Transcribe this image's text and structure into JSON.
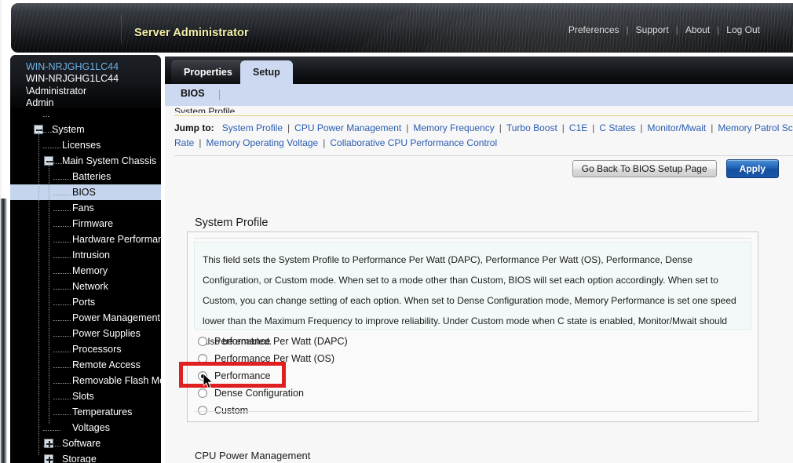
{
  "banner": {
    "app_title": "Server Administrator",
    "nav": [
      {
        "label": "Preferences"
      },
      {
        "label": "Support"
      },
      {
        "label": "About"
      },
      {
        "label": "Log Out"
      }
    ],
    "separator": "|"
  },
  "sidebar": {
    "header": {
      "host_link": "WIN-NRJGHG1LC44",
      "host": "WIN-NRJGHG1LC44",
      "user": "\\Administrator",
      "role": "Admin"
    },
    "tree": [
      {
        "label": "System",
        "toggle": "minus",
        "level": 0
      },
      {
        "label": "Licenses",
        "toggle": "none",
        "level": 1
      },
      {
        "label": "Main System Chassis",
        "toggle": "minus",
        "level": 1
      },
      {
        "label": "Batteries",
        "toggle": "none",
        "level": 2
      },
      {
        "label": "BIOS",
        "toggle": "none",
        "level": 2,
        "selected": true
      },
      {
        "label": "Fans",
        "toggle": "none",
        "level": 2
      },
      {
        "label": "Firmware",
        "toggle": "none",
        "level": 2
      },
      {
        "label": "Hardware Performance",
        "toggle": "none",
        "level": 2
      },
      {
        "label": "Intrusion",
        "toggle": "none",
        "level": 2
      },
      {
        "label": "Memory",
        "toggle": "none",
        "level": 2
      },
      {
        "label": "Network",
        "toggle": "none",
        "level": 2
      },
      {
        "label": "Ports",
        "toggle": "none",
        "level": 2
      },
      {
        "label": "Power Management",
        "toggle": "none",
        "level": 2
      },
      {
        "label": "Power Supplies",
        "toggle": "none",
        "level": 2
      },
      {
        "label": "Processors",
        "toggle": "none",
        "level": 2
      },
      {
        "label": "Remote Access",
        "toggle": "none",
        "level": 2
      },
      {
        "label": "Removable Flash Media",
        "toggle": "none",
        "level": 2
      },
      {
        "label": "Slots",
        "toggle": "none",
        "level": 2
      },
      {
        "label": "Temperatures",
        "toggle": "none",
        "level": 2
      },
      {
        "label": "Voltages",
        "toggle": "none",
        "level": 2
      },
      {
        "label": "Software",
        "toggle": "plus",
        "level": 1
      },
      {
        "label": "Storage",
        "toggle": "plus",
        "level": 1
      }
    ]
  },
  "tabs": [
    {
      "label": "Properties",
      "active": false
    },
    {
      "label": "Setup",
      "active": true
    }
  ],
  "subbar": {
    "crumb": "BIOS"
  },
  "jump": {
    "label": "Jump to:",
    "separator": "|",
    "links": [
      "System Profile",
      "CPU Power Management",
      "Memory Frequency",
      "Turbo Boost",
      "C1E",
      "C States",
      "Monitor/Mwait",
      "Memory Patrol Scrub",
      "Memory Refresh Rate",
      "Memory Operating Voltage",
      "Collaborative CPU Performance Control"
    ]
  },
  "buttons": {
    "go_back": "Go Back To BIOS Setup Page",
    "apply": "Apply"
  },
  "section": {
    "title": "System Profile",
    "description": "This field sets the System Profile to Performance Per Watt (DAPC), Performance Per Watt (OS), Performance, Dense Configuration, or Custom mode. When set to a mode other than Custom, BIOS will set each option accordingly. When set to Custom, you can change setting of each option. When set to Dense Configuration mode, Memory Performance is set one speed lower than the Maximum Frequency to improve reliability. Under Custom mode when C state is enabled, Monitor/Mwait should also be enabled.",
    "options": [
      {
        "label": "Performance Per Watt (DAPC)",
        "selected": false
      },
      {
        "label": "Performance Per Watt (OS)",
        "selected": false
      },
      {
        "label": "Performance",
        "selected": true
      },
      {
        "label": "Dense Configuration",
        "selected": false
      },
      {
        "label": "Custom",
        "selected": false
      }
    ]
  },
  "next_section_partial": "CPU Power Management",
  "colors": {
    "accent_blue": "#2a5db0",
    "tab_active_bg": "#ccd9f0",
    "apply_button": "#1d5fb4",
    "annotation_red": "#e02020",
    "title_yellow": "#f5f0a8",
    "host_link_blue": "#6fb4e8"
  }
}
